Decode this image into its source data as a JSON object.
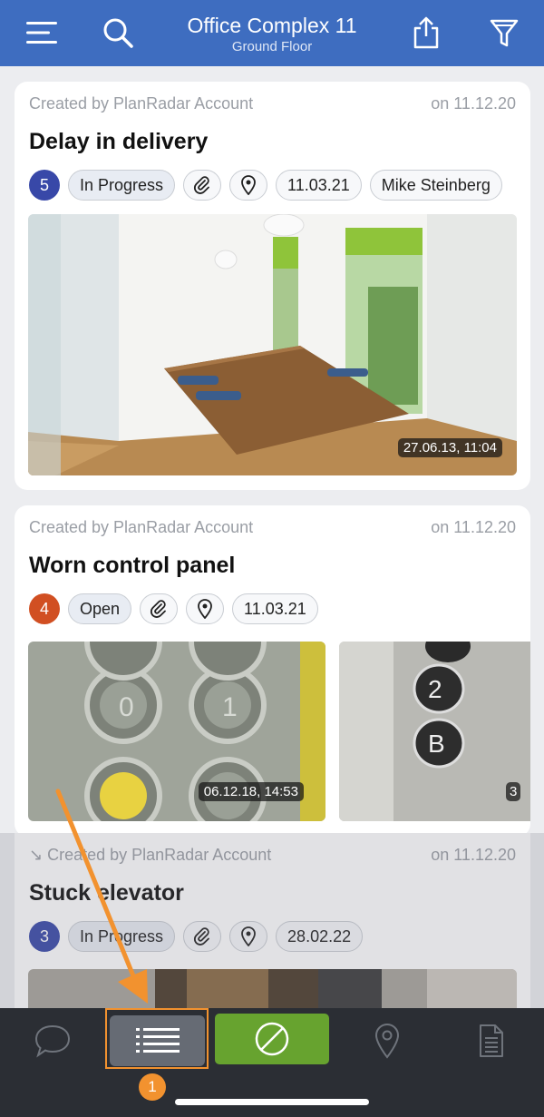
{
  "header": {
    "title": "Office Complex 11",
    "subtitle": "Ground Floor",
    "icons": [
      "menu-icon",
      "search-icon",
      "share-icon",
      "filter-icon"
    ]
  },
  "tickets": [
    {
      "created_by": "Created by PlanRadar Account",
      "created_on": "on 11.12.20",
      "title": "Delay in delivery",
      "number": "5",
      "number_color": "#3848a8",
      "status": "In Progress",
      "due_date": "11.03.21",
      "assignee": "Mike Steinberg",
      "photos": [
        {
          "timestamp": "27.06.13, 11:04"
        }
      ]
    },
    {
      "created_by": "Created by PlanRadar Account",
      "created_on": "on 11.12.20",
      "title": "Worn control panel",
      "number": "4",
      "number_color": "#d14f22",
      "status": "Open",
      "due_date": "11.03.21",
      "photos": [
        {
          "timestamp": "06.12.18, 14:53"
        },
        {
          "timestamp": "3"
        }
      ]
    },
    {
      "created_by": "↘ Created by PlanRadar Account",
      "created_on": "on 11.12.20",
      "title": "Stuck elevator",
      "number": "3",
      "number_color": "#3848a8",
      "status": "In Progress",
      "due_date": "28.02.22"
    }
  ],
  "tabbar": {
    "items": [
      "chat-icon",
      "list-icon",
      "no-filter-icon",
      "location-icon",
      "document-icon"
    ],
    "active": "list-icon",
    "active_color": "#67a32f"
  },
  "annotation": {
    "step": "1",
    "color": "#f2922f"
  }
}
